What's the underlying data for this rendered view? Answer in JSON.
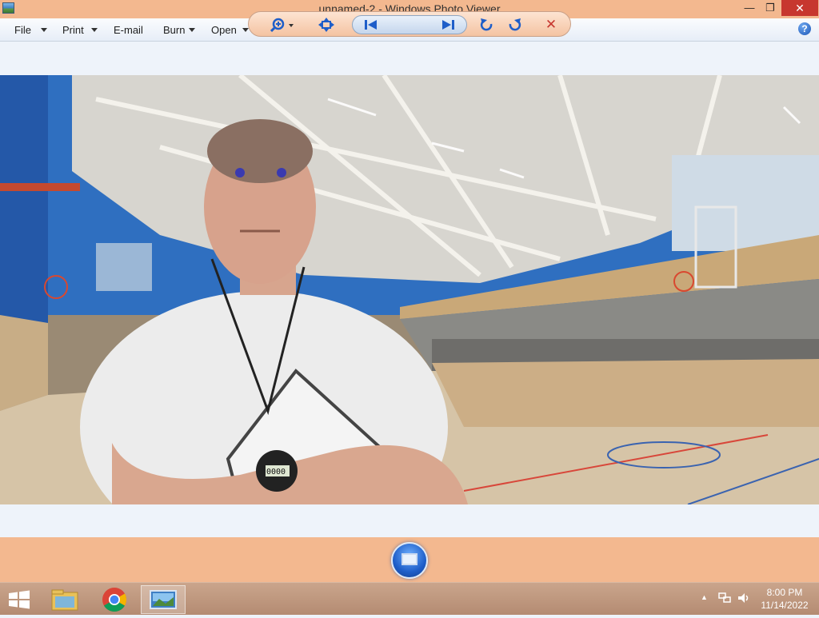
{
  "window": {
    "title": "unnamed-2 - Windows Photo Viewer",
    "minimize_glyph": "—",
    "maximize_glyph": "❐",
    "close_glyph": "✕"
  },
  "menu": {
    "file": "File",
    "print": "Print",
    "email": "E-mail",
    "burn": "Burn",
    "open": "Open",
    "help_glyph": "?"
  },
  "photo": {
    "badge_text": "",
    "stopwatch_text": "0000"
  },
  "controls": {
    "zoom_icon": "zoom-icon",
    "actual_size_icon": "actual-size-icon",
    "previous_icon": "previous-icon",
    "slideshow_icon": "slideshow-icon",
    "next_icon": "next-icon",
    "rotate_ccw_icon": "rotate-counterclockwise-icon",
    "rotate_cw_icon": "rotate-clockwise-icon",
    "delete_icon": "delete-icon",
    "delete_glyph": "✕"
  },
  "taskbar": {
    "apps": [
      "file-explorer",
      "chrome",
      "windows-photo-viewer"
    ],
    "clock_time": "8:00 PM",
    "clock_date": "11/14/2022"
  },
  "colors": {
    "frame": "#f3b88f",
    "accent_blue": "#1e5ec9",
    "close_red": "#c7372f"
  }
}
